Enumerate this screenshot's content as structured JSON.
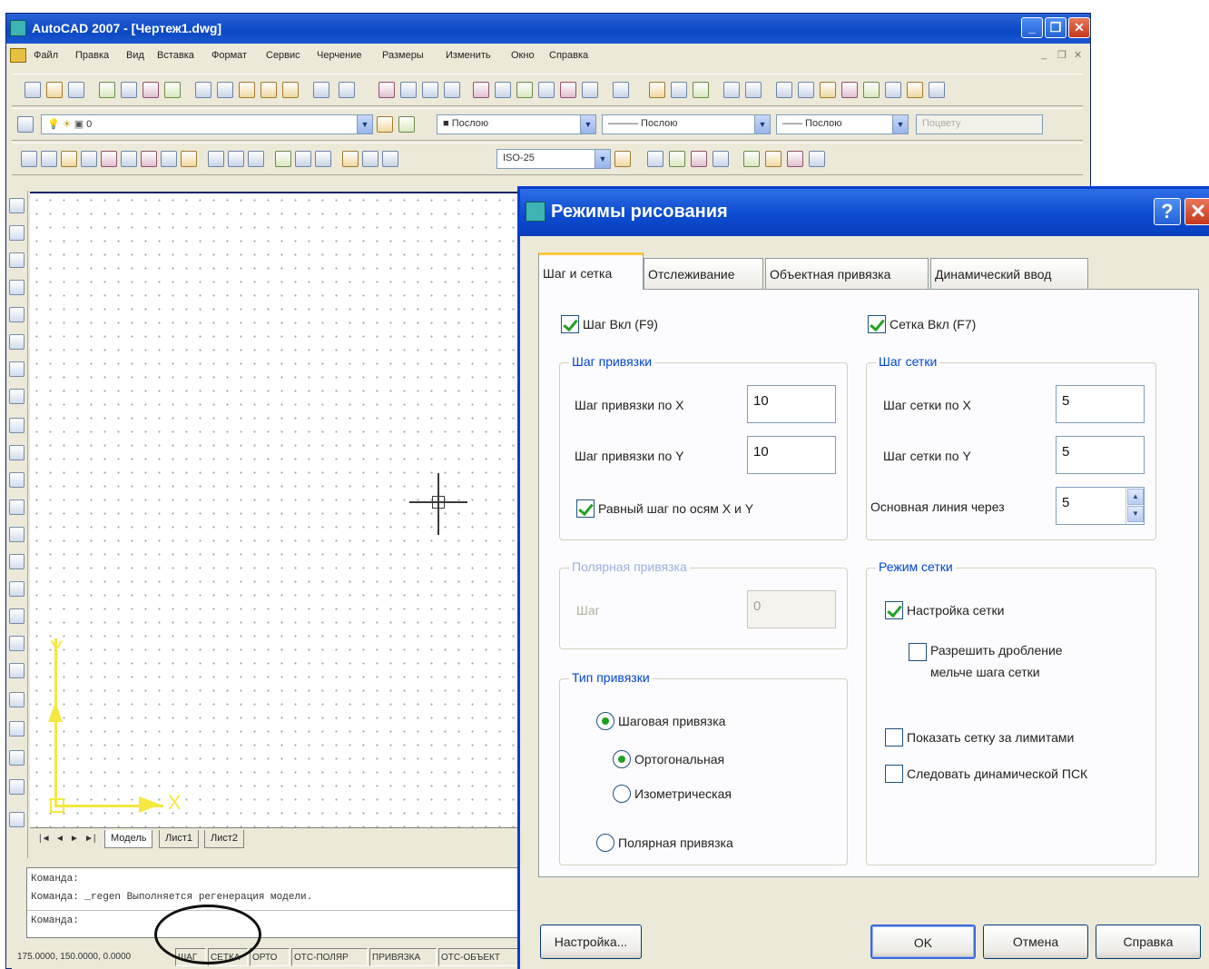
{
  "acad": {
    "title": "AutoCAD 2007 - [Чертеж1.dwg]",
    "menu": [
      "Файл",
      "Правка",
      "Вид",
      "Вставка",
      "Формат",
      "Сервис",
      "Черчение",
      "Размеры",
      "Изменить",
      "Окно",
      "Справка"
    ],
    "layer_combo": "0",
    "color_combo": "■ Послою",
    "linetype_combo": "——— Послою",
    "lineweight_combo": "—— Послою",
    "plotstyle_combo": "Поцвету",
    "dimstyle_combo": "ISO-25",
    "layout_tabs": [
      "Модель",
      "Лист1",
      "Лист2"
    ],
    "nav_arrows": [
      "|◄",
      "◄",
      "►",
      "►|"
    ],
    "ucs_x": "X",
    "ucs_y": "Y",
    "command_lines": [
      "Команда:",
      "Команда:  _regen  Выполняется регенерация модели.",
      "Команда:"
    ],
    "status_coords": "175.0000, 150.0000, 0.0000",
    "status_buttons": [
      "ШАГ",
      "СЕТКА",
      "ОРТО",
      "ОТС-ПОЛЯР",
      "ПРИВЯЗКА",
      "ОТС-ОБЪЕКТ"
    ]
  },
  "dialog": {
    "title": "Режимы рисования",
    "tabs": [
      "Шаг и сетка",
      "Отслеживание",
      "Объектная привязка",
      "Динамический ввод"
    ],
    "snap_on_label": "Шаг Вкл (F9)",
    "grid_on_label": "Сетка Вкл (F7)",
    "snap_spacing": {
      "title": "Шаг привязки",
      "x_label": "Шаг привязки по X",
      "x_value": "10",
      "y_label": "Шаг привязки по Y",
      "y_value": "10",
      "equal_label": "Равный шаг по осям X и Y"
    },
    "grid_spacing": {
      "title": "Шаг сетки",
      "x_label": "Шаг сетки по X",
      "x_value": "5",
      "y_label": "Шаг сетки по Y",
      "y_value": "5",
      "major_label": "Основная линия через",
      "major_value": "5"
    },
    "polar_spacing": {
      "title": "Полярная привязка",
      "label": "Шаг",
      "value": "0"
    },
    "grid_behavior": {
      "title": "Режим сетки",
      "adaptive_label": "Настройка сетки",
      "subdivision_label_1": "Разрешить дробление",
      "subdivision_label_2": "мельче шага сетки",
      "beyond_limits_label": "Показать сетку за лимитами",
      "follow_ucs_label": "Следовать динамической ПСК"
    },
    "snap_type": {
      "title": "Тип привязки",
      "grid_snap": "Шаговая привязка",
      "rectangular": "Ортогональная",
      "isometric": "Изометрическая",
      "polar_snap": "Полярная привязка"
    },
    "buttons": {
      "options": "Настройка...",
      "ok": "OK",
      "cancel": "Отмена",
      "help": "Справка"
    }
  }
}
